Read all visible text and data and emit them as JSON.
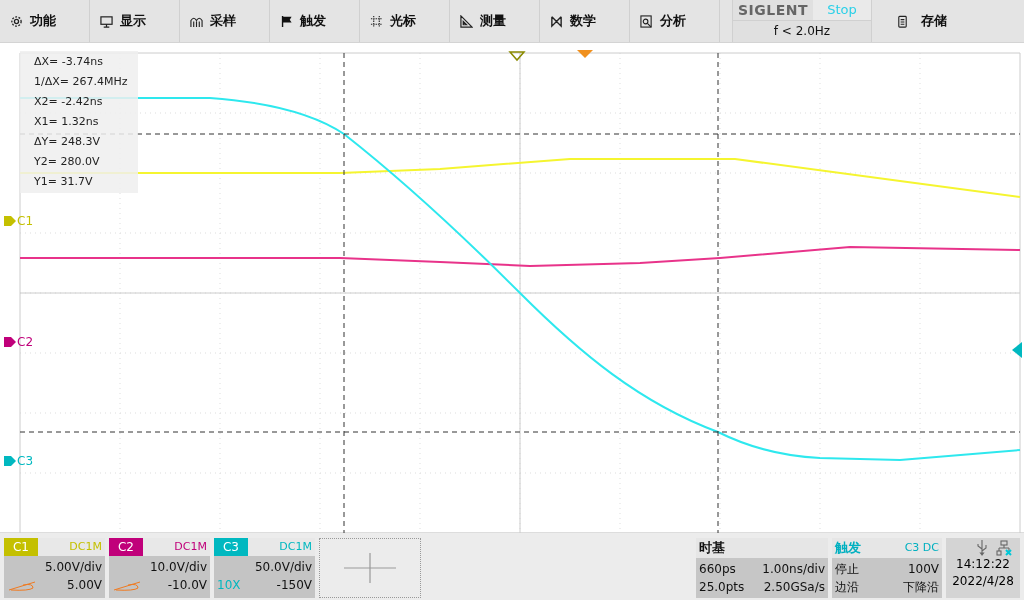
{
  "menu": [
    {
      "label": "功能"
    },
    {
      "label": "显示"
    },
    {
      "label": "采样"
    },
    {
      "label": "触发"
    },
    {
      "label": "光标"
    },
    {
      "label": "测量"
    },
    {
      "label": "数学"
    },
    {
      "label": "分析"
    }
  ],
  "status": {
    "brand": "SIGLENT",
    "run_state": "Stop",
    "frequency": "f < 2.0Hz"
  },
  "save": {
    "label": "存储"
  },
  "cursor_readout": [
    "ΔX= -3.74ns",
    "1/ΔX= 267.4MHz",
    "X2= -2.42ns",
    "X1= 1.32ns",
    "ΔY= 248.3V",
    "Y2= 280.0V",
    "Y1= 31.7V"
  ],
  "channel_markers": [
    {
      "label": "C1",
      "color": "#c4c000"
    },
    {
      "label": "C2",
      "color": "#c0007a"
    },
    {
      "label": "C3",
      "color": "#00b8c0"
    }
  ],
  "channels": [
    {
      "name": "C1",
      "coupling": "DC1M",
      "scale": "5.00V/div",
      "offset": "5.00V",
      "color": "#c4c000"
    },
    {
      "name": "C2",
      "coupling": "DC1M",
      "scale": "10.0V/div",
      "offset": "-10.0V",
      "color": "#c0007a"
    },
    {
      "name": "C3",
      "coupling": "DC1M",
      "scale": "50.0V/div",
      "offset": "-150V",
      "probe": "10X",
      "color": "#00b8c0"
    }
  ],
  "timebase": {
    "title": "时基",
    "delay": "660ps",
    "scale": "1.00ns/div",
    "points": "25.0pts",
    "sample_rate": "2.50GSa/s"
  },
  "trigger": {
    "title": "触发",
    "source": "C3",
    "coupling": "DC",
    "state": "停止",
    "level": "100V",
    "type": "边沿",
    "slope": "下降沿"
  },
  "clock": {
    "time": "14:12:22",
    "date": "2022/4/28"
  }
}
